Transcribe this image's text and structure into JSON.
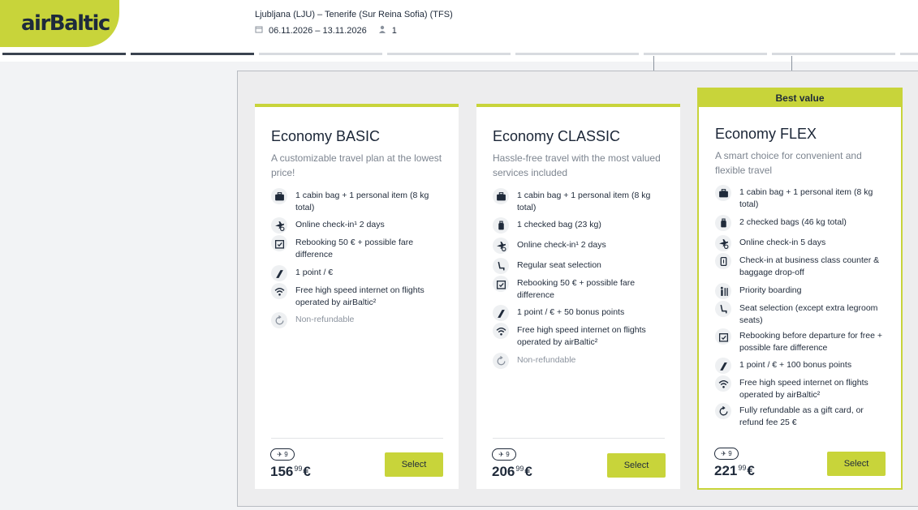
{
  "logo": "airBaltic",
  "trip": {
    "route": "Ljubljana (LJU) – Tenerife (Sur Reina Sofia) (TFS)",
    "dates": "06.11.2026 – 13.11.2026",
    "passengers": "1"
  },
  "fares": [
    {
      "name": "Economy BASIC",
      "description": "A customizable travel plan at the lowest price!",
      "features": [
        {
          "icon": "cabin-bag-icon",
          "text": "1 cabin bag + 1 personal item (8 kg total)"
        },
        {
          "icon": "online-checkin-icon",
          "text": "Online check-in¹ 2 days"
        },
        {
          "icon": "rebooking-calendar-icon",
          "text": "Rebooking 50 € + possible fare difference"
        },
        {
          "icon": "points-icon",
          "text": "1 point / €"
        },
        {
          "icon": "wifi-icon",
          "text": "Free high speed internet on flights operated by airBaltic²"
        },
        {
          "icon": "refund-icon",
          "text": "Non-refundable",
          "muted": true
        }
      ],
      "points_badge": "9",
      "price_main": "156",
      "price_cents": "99",
      "currency": "€",
      "select_label": "Select"
    },
    {
      "name": "Economy CLASSIC",
      "description": "Hassle-free travel with the most valued services included",
      "features": [
        {
          "icon": "cabin-bag-icon",
          "text": "1 cabin bag + 1 personal item (8 kg total)"
        },
        {
          "icon": "checked-bag-icon",
          "text": "1 checked bag (23 kg)"
        },
        {
          "icon": "online-checkin-icon",
          "text": "Online check-in¹ 2 days"
        },
        {
          "icon": "seat-icon",
          "text": "Regular seat selection"
        },
        {
          "icon": "rebooking-calendar-icon",
          "text": "Rebooking 50 € + possible fare difference"
        },
        {
          "icon": "points-icon",
          "text": "1 point / € + 50 bonus points"
        },
        {
          "icon": "wifi-icon",
          "text": "Free high speed internet on flights operated by airBaltic²"
        },
        {
          "icon": "refund-icon",
          "text": "Non-refundable",
          "muted": true
        }
      ],
      "points_badge": "9",
      "price_main": "206",
      "price_cents": "99",
      "currency": "€",
      "select_label": "Select"
    },
    {
      "name": "Economy FLEX",
      "badge": "Best value",
      "description": "A smart choice for convenient and flexible travel",
      "features": [
        {
          "icon": "cabin-bag-icon",
          "text": "1 cabin bag + 1 personal item (8 kg total)"
        },
        {
          "icon": "checked-bag-icon",
          "text": "2 checked bags (46 kg total)"
        },
        {
          "icon": "online-checkin-icon",
          "text": "Online check-in 5 days"
        },
        {
          "icon": "business-counter-icon",
          "text": "Check-in at business class counter & baggage drop-off"
        },
        {
          "icon": "priority-boarding-icon",
          "text": "Priority boarding"
        },
        {
          "icon": "seat-icon",
          "text": "Seat selection (except extra legroom seats)"
        },
        {
          "icon": "rebooking-calendar-icon",
          "text": "Rebooking before departure for free + possible fare difference"
        },
        {
          "icon": "points-icon",
          "text": "1 point / € + 100 bonus points"
        },
        {
          "icon": "wifi-icon",
          "text": "Free high speed internet on flights operated by airBaltic²"
        },
        {
          "icon": "refund-icon",
          "text": "Fully refundable as a gift card, or refund fee 25 €"
        }
      ],
      "points_badge": "9",
      "price_main": "221",
      "price_cents": "99",
      "currency": "€",
      "select_label": "Select"
    }
  ],
  "colors": {
    "accent": "#c8d43a",
    "dark": "#1f2a3a",
    "muted": "#8b939e"
  }
}
